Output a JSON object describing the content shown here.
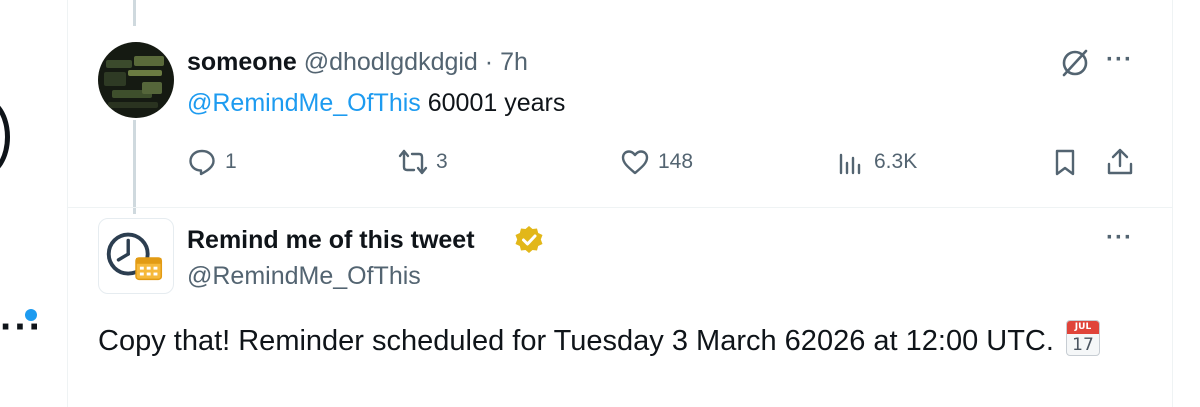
{
  "reply_tweet": {
    "display_name": "someone",
    "handle": "@dhodlgdkdgid",
    "separator": "·",
    "time": "7h",
    "mention": "@RemindMe_OfThis",
    "text": "60001 years",
    "actions": {
      "replies": "1",
      "retweets": "3",
      "likes": "148",
      "views": "6.3K"
    },
    "icons": [
      "grok-icon",
      "more-icon",
      "reply-icon",
      "retweet-icon",
      "like-icon",
      "views-icon",
      "bookmark-icon",
      "share-icon"
    ]
  },
  "bot_tweet": {
    "display_name": "Remind me of this tweet",
    "handle": "@RemindMe_OfThis",
    "text": "Copy that! Reminder scheduled for Tuesday 3 March 62026 at 12:00 UTC.",
    "emoji": {
      "name": "calendar-emoji",
      "month": "JUL",
      "day": "17"
    },
    "icons": [
      "verified-badge-icon",
      "more-icon",
      "clock-calendar-avatar"
    ]
  },
  "colors": {
    "link": "#1d9bf0",
    "secondary_text": "#536471",
    "primary_text": "#0f1419",
    "verified_gold": "#e2b719"
  }
}
